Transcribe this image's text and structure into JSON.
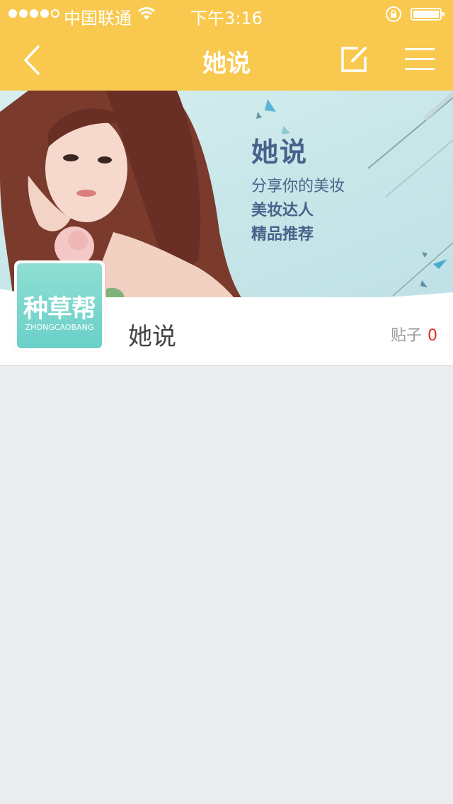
{
  "status_bar": {
    "carrier": "中国联通",
    "time": "下午3:16"
  },
  "nav": {
    "title": "她说"
  },
  "banner": {
    "title": "她说",
    "line1": "分享你的美妆",
    "line2": "美妆达人",
    "line3": "精品推荐"
  },
  "group": {
    "logo_text": "种草帮",
    "logo_subtext": "ZHONGCAOBANG",
    "name": "她说",
    "posts_label": "贴子",
    "posts_count": "0"
  },
  "colors": {
    "header": "#f8c94e",
    "background": "#ebedf0",
    "accent_red": "#e02a2a",
    "logo_teal": "#6ad0c8"
  },
  "icons": [
    "signal-dots-icon",
    "wifi-icon",
    "rotation-lock-icon",
    "battery-icon",
    "back-chevron-icon",
    "edit-icon",
    "menu-icon"
  ]
}
